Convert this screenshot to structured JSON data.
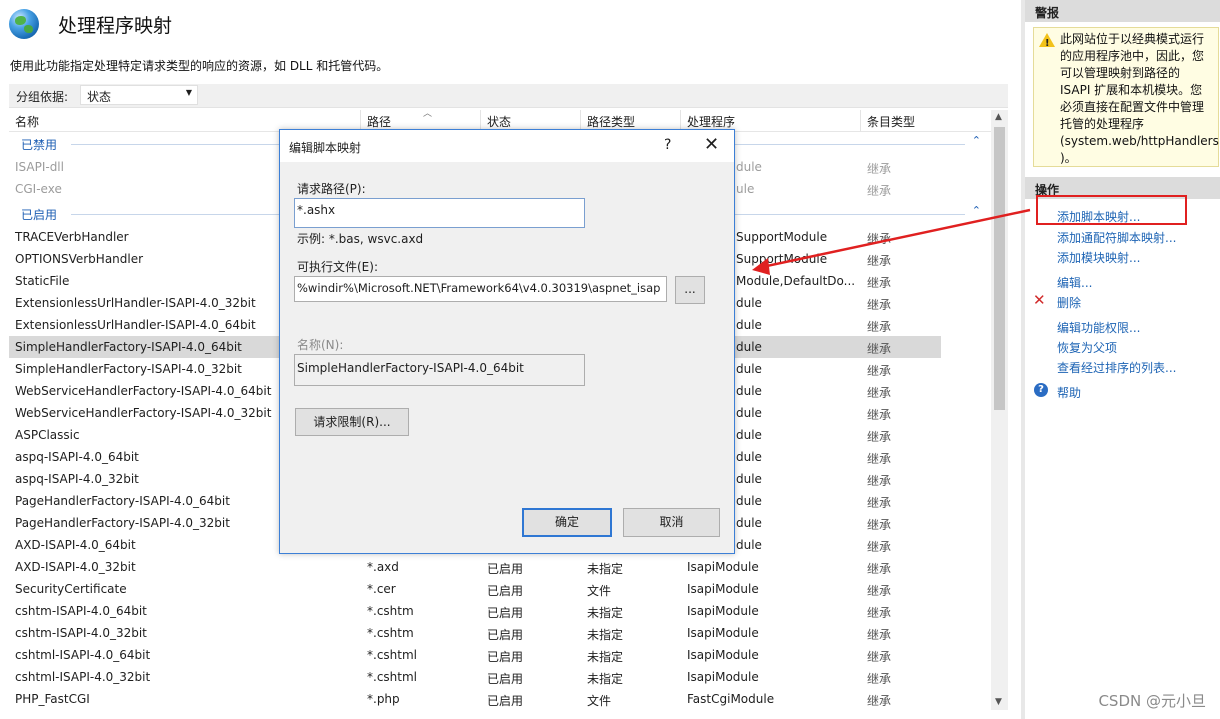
{
  "header": {
    "title": "处理程序映射",
    "description": "使用此功能指定处理特定请求类型的响应的资源，如 DLL 和托管代码。"
  },
  "groupby": {
    "label": "分组依据:",
    "value": "状态"
  },
  "columns": [
    "名称",
    "路径",
    "状态",
    "路径类型",
    "处理程序",
    "条目类型"
  ],
  "groups": {
    "disabled": "已禁用",
    "enabled": "已启用"
  },
  "rows": [
    {
      "name": "ISAPI-dll",
      "path": "",
      "state": "",
      "ptype": "",
      "handler": "dule",
      "entry": "继承"
    },
    {
      "name": "CGI-exe",
      "path": "",
      "state": "",
      "ptype": "",
      "handler": "ule",
      "entry": "继承"
    },
    {
      "name": "TRACEVerbHandler",
      "path": "",
      "state": "",
      "ptype": "",
      "handler": "SupportModule",
      "entry": "继承"
    },
    {
      "name": "OPTIONSVerbHandler",
      "path": "",
      "state": "",
      "ptype": "",
      "handler": "SupportModule",
      "entry": "继承"
    },
    {
      "name": "StaticFile",
      "path": "",
      "state": "",
      "ptype": "",
      "handler": "Module,DefaultDo...",
      "entry": "继承"
    },
    {
      "name": "ExtensionlessUrlHandler-ISAPI-4.0_32bit",
      "path": "",
      "state": "",
      "ptype": "",
      "handler": "dule",
      "entry": "继承"
    },
    {
      "name": "ExtensionlessUrlHandler-ISAPI-4.0_64bit",
      "path": "",
      "state": "",
      "ptype": "",
      "handler": "dule",
      "entry": "继承"
    },
    {
      "name": "SimpleHandlerFactory-ISAPI-4.0_64bit",
      "path": "",
      "state": "",
      "ptype": "",
      "handler": "dule",
      "entry": "继承"
    },
    {
      "name": "SimpleHandlerFactory-ISAPI-4.0_32bit",
      "path": "",
      "state": "",
      "ptype": "",
      "handler": "dule",
      "entry": "继承"
    },
    {
      "name": "WebServiceHandlerFactory-ISAPI-4.0_64bit",
      "path": "",
      "state": "",
      "ptype": "",
      "handler": "dule",
      "entry": "继承"
    },
    {
      "name": "WebServiceHandlerFactory-ISAPI-4.0_32bit",
      "path": "",
      "state": "",
      "ptype": "",
      "handler": "dule",
      "entry": "继承"
    },
    {
      "name": "ASPClassic",
      "path": "",
      "state": "",
      "ptype": "",
      "handler": "dule",
      "entry": "继承"
    },
    {
      "name": "aspq-ISAPI-4.0_64bit",
      "path": "",
      "state": "",
      "ptype": "",
      "handler": "dule",
      "entry": "继承"
    },
    {
      "name": "aspq-ISAPI-4.0_32bit",
      "path": "",
      "state": "",
      "ptype": "",
      "handler": "dule",
      "entry": "继承"
    },
    {
      "name": "PageHandlerFactory-ISAPI-4.0_64bit",
      "path": "",
      "state": "",
      "ptype": "",
      "handler": "dule",
      "entry": "继承"
    },
    {
      "name": "PageHandlerFactory-ISAPI-4.0_32bit",
      "path": "",
      "state": "",
      "ptype": "",
      "handler": "dule",
      "entry": "继承"
    },
    {
      "name": "AXD-ISAPI-4.0_64bit",
      "path": "",
      "state": "",
      "ptype": "",
      "handler": "dule",
      "entry": "继承"
    },
    {
      "name": "AXD-ISAPI-4.0_32bit",
      "path": "*.axd",
      "state": "已启用",
      "ptype": "未指定",
      "handler": "IsapiModule",
      "entry": "继承"
    },
    {
      "name": "SecurityCertificate",
      "path": "*.cer",
      "state": "已启用",
      "ptype": "文件",
      "handler": "IsapiModule",
      "entry": "继承"
    },
    {
      "name": "cshtm-ISAPI-4.0_64bit",
      "path": "*.cshtm",
      "state": "已启用",
      "ptype": "未指定",
      "handler": "IsapiModule",
      "entry": "继承"
    },
    {
      "name": "cshtm-ISAPI-4.0_32bit",
      "path": "*.cshtm",
      "state": "已启用",
      "ptype": "未指定",
      "handler": "IsapiModule",
      "entry": "继承"
    },
    {
      "name": "cshtml-ISAPI-4.0_64bit",
      "path": "*.cshtml",
      "state": "已启用",
      "ptype": "未指定",
      "handler": "IsapiModule",
      "entry": "继承"
    },
    {
      "name": "cshtml-ISAPI-4.0_32bit",
      "path": "*.cshtml",
      "state": "已启用",
      "ptype": "未指定",
      "handler": "IsapiModule",
      "entry": "继承"
    },
    {
      "name": "PHP_FastCGI",
      "path": "*.php",
      "state": "已启用",
      "ptype": "文件",
      "handler": "FastCgiModule",
      "entry": "继承"
    }
  ],
  "right_pane": {
    "alerts_header": "警报",
    "alert_lines": [
      "此网站位于以经典模式运行",
      "的应用程序池中，因此，您",
      "可以管理映射到路径的",
      "ISAPI 扩展和本机模块。您",
      "必须直接在配置文件中管理",
      "托管的处理程序",
      "(system.web/httpHandlers",
      ")。"
    ],
    "actions_header": "操作",
    "actions": [
      "添加脚本映射...",
      "添加通配符脚本映射...",
      "添加模块映射...",
      "编辑...",
      "删除",
      "编辑功能权限...",
      "恢复为父项",
      "查看经过排序的列表...",
      "帮助"
    ]
  },
  "dialog": {
    "title": "编辑脚本映射",
    "help": "?",
    "close": "✕",
    "request_path_label": "请求路径(P):",
    "request_path_value": "*.ashx",
    "example_text": "示例: *.bas, wsvc.axd",
    "executable_label": "可执行文件(E):",
    "executable_value": "%windir%\\Microsoft.NET\\Framework64\\v4.0.30319\\aspnet_isap",
    "browse_label": "...",
    "name_label": "名称(N):",
    "name_value": "SimpleHandlerFactory-ISAPI-4.0_64bit",
    "restrictions_button": "请求限制(R)...",
    "ok_button": "确定",
    "cancel_button": "取消"
  },
  "watermark": "CSDN @元小旦",
  "colors": {
    "accent": "#1e64b4",
    "annotation": "#e02020",
    "selected_row": "#d9d9d9",
    "alert_bg": "#fffde3"
  }
}
